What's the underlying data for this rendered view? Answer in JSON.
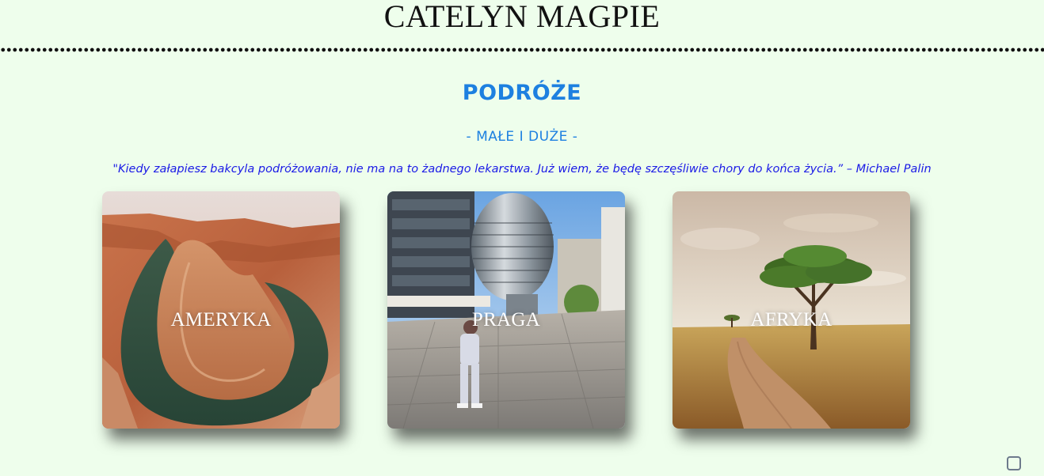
{
  "header": {
    "site_title": "CATELYN MAGPIE"
  },
  "section": {
    "title": "PODRÓŻE",
    "subtitle": "- MAŁE I DUŻE -",
    "quote": "\"Kiedy załapiesz bakcyla podróżowania, nie ma na to żadnego lekarstwa. Już wiem, że będę szczęśliwie chory do końca życia.” – Michael Palin"
  },
  "cards": [
    {
      "label": "AMERYKA",
      "image": "canyon-photo"
    },
    {
      "label": "PRAGA",
      "image": "city-sculpture-photo"
    },
    {
      "label": "AFRYKA",
      "image": "savanna-tree-photo"
    }
  ],
  "colors": {
    "background": "#eefeec",
    "heading_blue": "#1d80e0",
    "quote_blue": "#1a1ae6",
    "title_black": "#111111"
  },
  "icons": {
    "corner_widget": "square-outline-icon"
  }
}
